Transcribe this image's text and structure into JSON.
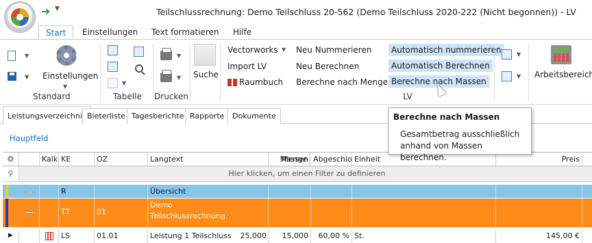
{
  "window": {
    "title": "Teilschlussrechnung: Demo Teilschluss 20-562 (Demo Teilschluss 2020-222 (Nicht begonnen)) - LV"
  },
  "ribbon_tabs": [
    "Start",
    "Einstellungen",
    "Text formatieren",
    "Hilfe"
  ],
  "ribbon": {
    "standard": {
      "einstellungen_label": "Einstellungen",
      "group_label": "Standard"
    },
    "tabelle": {
      "group_label": "Tabelle"
    },
    "drucken": {
      "group_label": "Drucken"
    },
    "suche": {
      "label": "Suche"
    },
    "lv": {
      "vectorworks": "Vectorworks",
      "import_lv": "Import LV",
      "raumbuch": "Raumbuch",
      "neu_nummerieren": "Neu Nummerieren",
      "neu_berechnen": "Neu Berechnen",
      "berechne_nach_menge": "Berechne nach Menge",
      "automatisch_nummerieren": "Automatisch nummerieren",
      "automatisch_berechnen": "Automatisch Berechnen",
      "berechne_nach_massen": "Berechne nach Massen",
      "group_label": "LV"
    },
    "arbeitsbereich": {
      "label": "Arbeitsbereich"
    }
  },
  "tooltip": {
    "title": "Berechne nach Massen",
    "line1": "Gesamtbetrag ausschließlich",
    "line2": "anhand von Massen berechnen."
  },
  "doc_tabs": [
    "Leistungsverzeichnis",
    "Bieterliste",
    "Tagesberichte",
    "Rapporte",
    "Dokumente"
  ],
  "hauptfeld": "Hauptfeld",
  "grid": {
    "columns": [
      "Kalk",
      "KE",
      "OZ",
      "Langtext",
      "Menge",
      "Massen",
      "Abgeschlos",
      "Einheit",
      "Preis"
    ],
    "filter_hint": "Hier klicken, um einen Filter zu definieren",
    "rows": [
      {
        "ke": "R",
        "oz": "",
        "langtext": "Übersicht",
        "menge": "",
        "massen": "",
        "abg": "",
        "einheit": "",
        "preis": "",
        "color": "#87c4ea"
      },
      {
        "ke": "TT",
        "oz": "01",
        "langtext": "Demo",
        "langtext2": "Teilschlussrechnung",
        "menge": "",
        "massen": "",
        "abg": "",
        "einheit": "",
        "preis": "",
        "color": "#ff8c1a"
      },
      {
        "ke": "LS",
        "oz": "01.01",
        "langtext": "Leistung 1 Teilschluss",
        "menge": "25,000",
        "massen": "15,000",
        "abg": "60,00 %",
        "einheit": "St.",
        "preis": "145,00 €",
        "color": "#ffffff"
      }
    ]
  },
  "colors": {
    "accent": "#1b6ac9",
    "highlight": "#cde3f7",
    "orange": "#ff8c1a",
    "blue_row": "#87c4ea"
  }
}
